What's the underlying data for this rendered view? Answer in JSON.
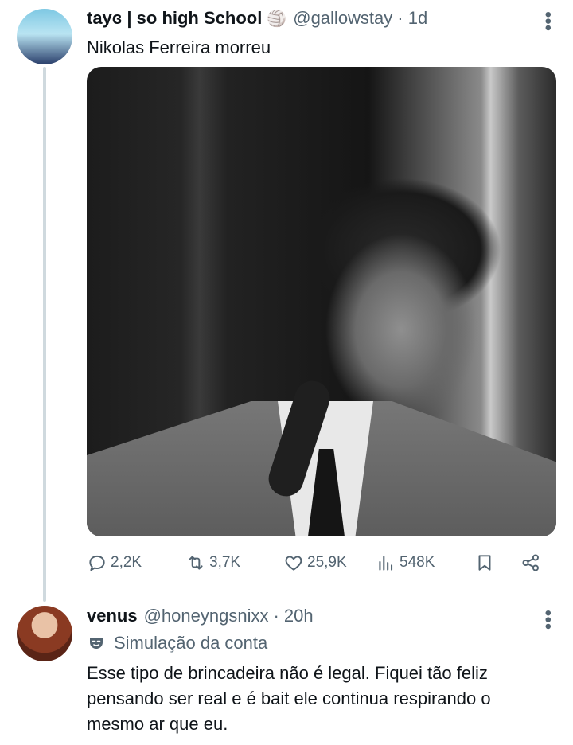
{
  "tweet": {
    "display_name": "tayɞ | so high School",
    "badge_emoji": "🏐",
    "handle": "@gallowstay",
    "time": "· 1d",
    "text": "Nikolas Ferreira morreu",
    "stats": {
      "replies": "2,2K",
      "retweets": "3,7K",
      "likes": "25,9K",
      "views": "548K"
    }
  },
  "reply": {
    "display_name": "venus",
    "handle": "@honeyngsnixx",
    "time": "· 20h",
    "simulation_label": "Simulação da conta",
    "text": "Esse tipo de brincadeira não é legal. Fiquei tão feliz pensando ser real e é bait ele continua respirando o mesmo ar que eu."
  },
  "icons": [
    "more-icon",
    "reply-icon",
    "retweet-icon",
    "like-icon",
    "views-icon",
    "bookmark-icon",
    "share-icon",
    "mask-icon"
  ],
  "colors": {
    "text": "#0f1419",
    "secondary": "#536471",
    "thread_line": "#cfd9de"
  }
}
